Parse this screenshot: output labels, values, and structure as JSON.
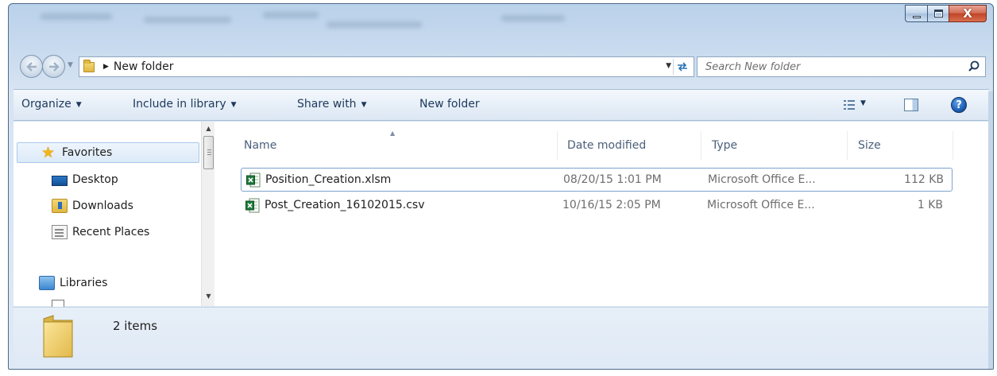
{
  "window": {
    "caption_buttons": [
      "minimize",
      "maximize",
      "close"
    ],
    "close_glyph": "X",
    "accent_color": "#b9d1ea"
  },
  "navigation": {
    "back_icon": "back-arrow-icon",
    "forward_icon": "forward-arrow-icon"
  },
  "address_bar": {
    "path_separator": "▶",
    "current_folder": "New folder",
    "dropdown_glyph": "▼",
    "refresh_glyph": "↹"
  },
  "search": {
    "placeholder": "Search New folder"
  },
  "toolbar": {
    "items": [
      {
        "label": "Organize",
        "has_dropdown": true
      },
      {
        "label": "Include in library",
        "has_dropdown": true
      },
      {
        "label": "Share with",
        "has_dropdown": true
      },
      {
        "label": "New folder",
        "has_dropdown": false
      }
    ],
    "caret": "▼",
    "help_glyph": "?"
  },
  "sidebar": {
    "items": [
      {
        "label": "Favorites",
        "icon": "star-icon",
        "selected": true
      },
      {
        "label": "Desktop",
        "icon": "desktop-icon"
      },
      {
        "label": "Downloads",
        "icon": "downloads-icon"
      },
      {
        "label": "Recent Places",
        "icon": "recent-places-icon"
      },
      {
        "label": "Libraries",
        "icon": "libraries-icon"
      }
    ]
  },
  "file_list": {
    "columns": [
      "Name",
      "Date modified",
      "Type",
      "Size"
    ],
    "sort_glyph": "▲",
    "rows": [
      {
        "name": "Position_Creation.xlsm",
        "date": "08/20/15 1:01 PM",
        "type": "Microsoft Office E...",
        "size": "112 KB",
        "icon": "excel-file-icon",
        "focused": true
      },
      {
        "name": "Post_Creation_16102015.csv",
        "date": "10/16/15 2:05 PM",
        "type": "Microsoft Office E...",
        "size": "1 KB",
        "icon": "excel-file-icon",
        "focused": false
      }
    ]
  },
  "details_pane": {
    "item_count": "2 items"
  }
}
